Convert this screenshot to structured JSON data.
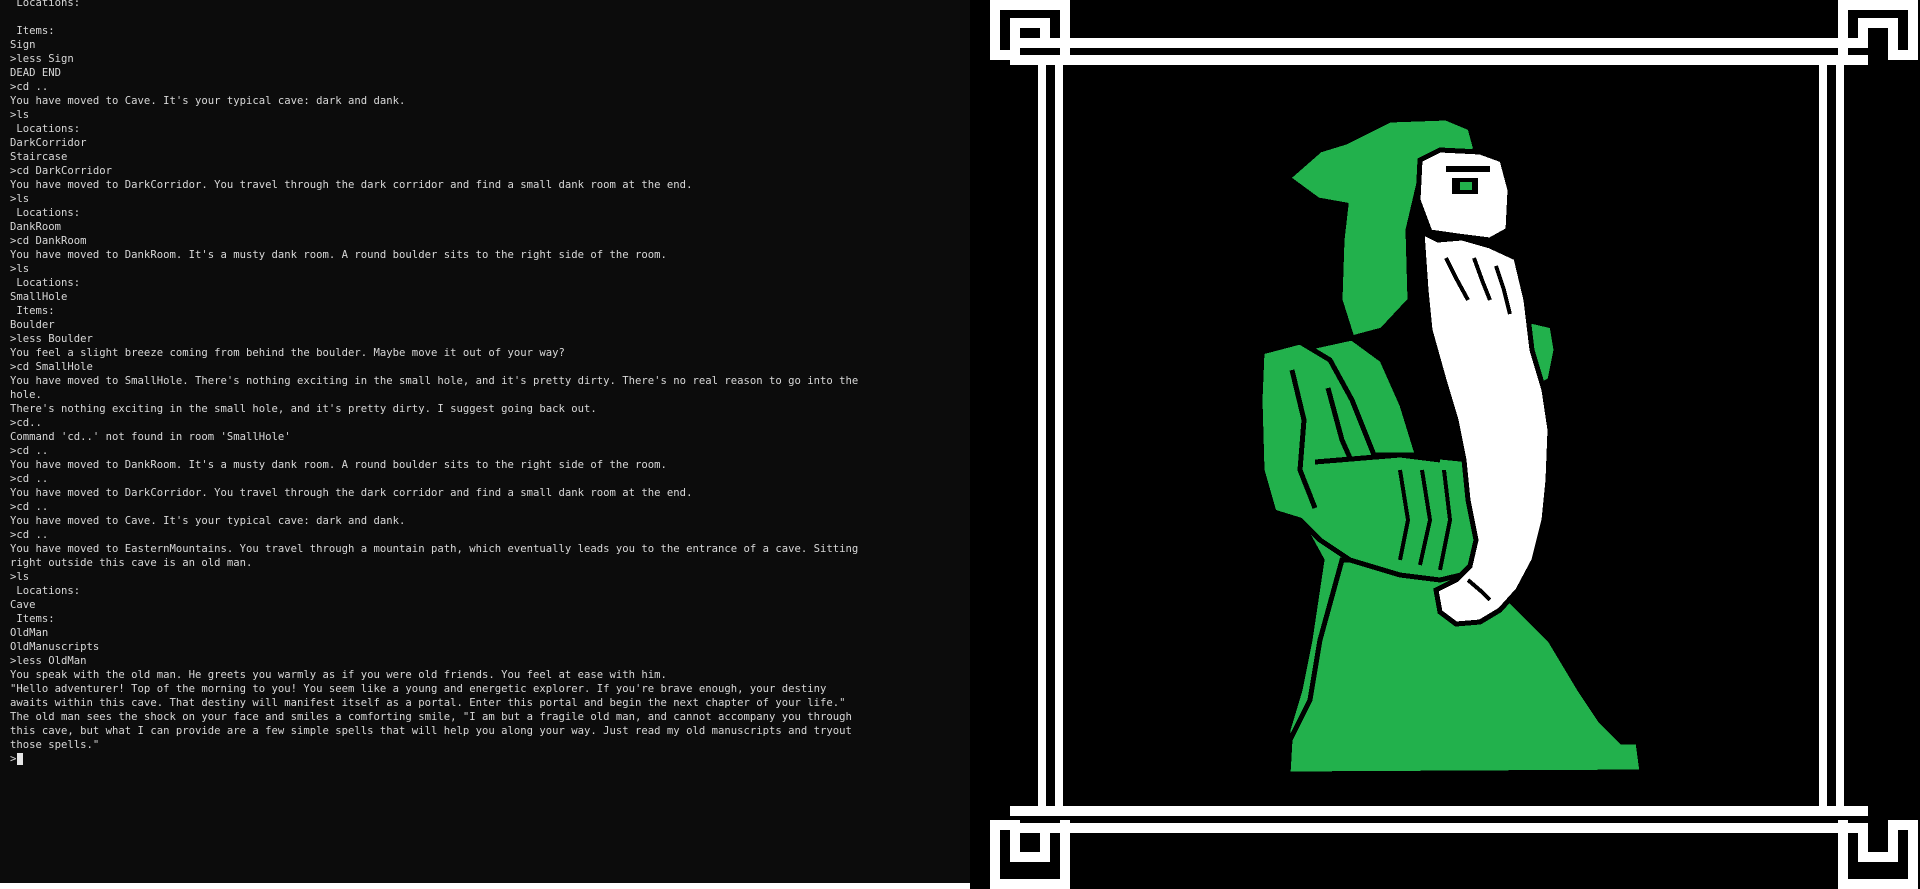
{
  "terminal": {
    "lines": [
      {
        "text": " Locations:",
        "kind": "out"
      },
      {
        "text": "",
        "kind": "gap"
      },
      {
        "text": " Items:",
        "kind": "out"
      },
      {
        "text": "Sign",
        "kind": "out"
      },
      {
        "text": ">less Sign",
        "kind": "cmd"
      },
      {
        "text": "DEAD END",
        "kind": "out"
      },
      {
        "text": ">cd ..",
        "kind": "cmd"
      },
      {
        "text": "You have moved to Cave. It's your typical cave: dark and dank.",
        "kind": "out"
      },
      {
        "text": ">ls",
        "kind": "cmd"
      },
      {
        "text": " Locations:",
        "kind": "out"
      },
      {
        "text": "DarkCorridor",
        "kind": "out"
      },
      {
        "text": "Staircase",
        "kind": "out"
      },
      {
        "text": ">cd DarkCorridor",
        "kind": "cmd"
      },
      {
        "text": "You have moved to DarkCorridor. You travel through the dark corridor and find a small dank room at the end.",
        "kind": "out"
      },
      {
        "text": ">ls",
        "kind": "cmd"
      },
      {
        "text": " Locations:",
        "kind": "out"
      },
      {
        "text": "DankRoom",
        "kind": "out"
      },
      {
        "text": ">cd DankRoom",
        "kind": "cmd"
      },
      {
        "text": "You have moved to DankRoom. It's a musty dank room. A round boulder sits to the right side of the room.",
        "kind": "out"
      },
      {
        "text": ">ls",
        "kind": "cmd"
      },
      {
        "text": " Locations:",
        "kind": "out"
      },
      {
        "text": "SmallHole",
        "kind": "out"
      },
      {
        "text": " Items:",
        "kind": "out"
      },
      {
        "text": "Boulder",
        "kind": "out"
      },
      {
        "text": ">less Boulder",
        "kind": "cmd"
      },
      {
        "text": "You feel a slight breeze coming from behind the boulder. Maybe move it out of your way?",
        "kind": "out"
      },
      {
        "text": ">cd SmallHole",
        "kind": "cmd"
      },
      {
        "text": "You have moved to SmallHole. There's nothing exciting in the small hole, and it's pretty dirty. There's no real reason to go into the",
        "kind": "out"
      },
      {
        "text": "hole.",
        "kind": "out"
      },
      {
        "text": "There's nothing exciting in the small hole, and it's pretty dirty. I suggest going back out.",
        "kind": "out"
      },
      {
        "text": ">cd..",
        "kind": "cmd"
      },
      {
        "text": "Command 'cd..' not found in room 'SmallHole'",
        "kind": "out"
      },
      {
        "text": ">cd ..",
        "kind": "cmd"
      },
      {
        "text": "You have moved to DankRoom. It's a musty dank room. A round boulder sits to the right side of the room.",
        "kind": "out"
      },
      {
        "text": ">cd ..",
        "kind": "cmd"
      },
      {
        "text": "You have moved to DarkCorridor. You travel through the dark corridor and find a small dank room at the end.",
        "kind": "out"
      },
      {
        "text": ">cd ..",
        "kind": "cmd"
      },
      {
        "text": "You have moved to Cave. It's your typical cave: dark and dank.",
        "kind": "out"
      },
      {
        "text": ">cd ..",
        "kind": "cmd"
      },
      {
        "text": "You have moved to EasternMountains. You travel through a mountain path, which eventually leads you to the entrance of a cave. Sitting",
        "kind": "out"
      },
      {
        "text": "right outside this cave is an old man.",
        "kind": "out"
      },
      {
        "text": ">ls",
        "kind": "cmd"
      },
      {
        "text": " Locations:",
        "kind": "out"
      },
      {
        "text": "Cave",
        "kind": "out"
      },
      {
        "text": " Items:",
        "kind": "out"
      },
      {
        "text": "OldMan",
        "kind": "out"
      },
      {
        "text": "OldManuscripts",
        "kind": "out"
      },
      {
        "text": ">less OldMan",
        "kind": "cmd"
      },
      {
        "text": "You speak with the old man. He greets you warmly as if you were old friends. You feel at ease with him.",
        "kind": "out"
      },
      {
        "text": "\"Hello adventurer! Top of the morning to you! You seem like a young and energetic explorer. If you're brave enough, your destiny",
        "kind": "out"
      },
      {
        "text": "awaits within this cave. That destiny will manifest itself as a portal. Enter this portal and begin the next chapter of your life.\"",
        "kind": "out"
      },
      {
        "text": "The old man sees the shock on your face and smiles a comforting smile, \"I am but a fragile old man, and cannot accompany you through",
        "kind": "out"
      },
      {
        "text": "this cave, but what I can provide are a few simple spells that will help you along your way. Just read my old manuscripts and tryout",
        "kind": "out"
      },
      {
        "text": "those spells.\"",
        "kind": "out"
      }
    ],
    "prompt": ">",
    "colors": {
      "background": "#0c0c0c",
      "text": "#d8d8d8"
    }
  },
  "art": {
    "subject": "old-wizard-in-green-robe",
    "colors": {
      "background": "#000000",
      "frame": "#ffffff",
      "robe": "#22b14c",
      "beard": "#ffffff",
      "outline": "#000000"
    }
  }
}
